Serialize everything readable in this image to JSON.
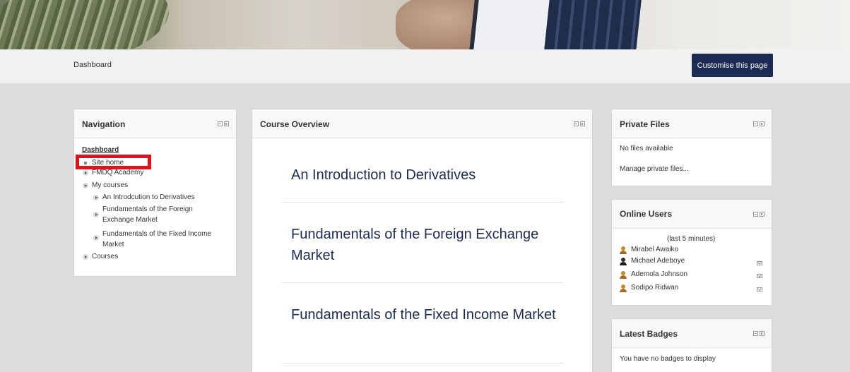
{
  "header": {
    "breadcrumb": "Dashboard",
    "customise_label": "Customise this page"
  },
  "navigation": {
    "title": "Navigation",
    "dashboard": "Dashboard",
    "site_home": "Site home",
    "fmdq_academy": "FMDQ Academy",
    "my_courses": "My courses",
    "courses": [
      "An Introdcution to Derivatives",
      "Fundamentals of the Foreign",
      "Exchange Market",
      "Fundamentals of the Fixed Income",
      "Market"
    ],
    "courses_link": "Courses"
  },
  "overview": {
    "title": "Course Overview",
    "course1": "An Introduction to Derivatives",
    "course2": "Fundamentals of the Foreign Exchange Market",
    "course3": "Fundamentals of the Fixed Income Market"
  },
  "private_files": {
    "title": "Private Files",
    "empty": "No files available",
    "manage": "Manage private files..."
  },
  "online_users": {
    "title": "Online Users",
    "period": "(last 5 minutes)",
    "users": [
      "Mirabel Awaiko",
      "Michael Adeboye",
      "Ademola Johnson",
      "Sodipo Ridwan"
    ]
  },
  "badges": {
    "title": "Latest Badges",
    "empty": "You have no badges to display"
  },
  "colors": {
    "brand": "#1b2b52",
    "highlight": "#e2121b"
  }
}
